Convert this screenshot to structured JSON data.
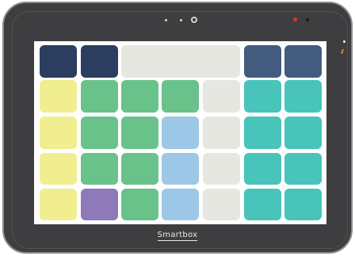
{
  "device": {
    "brand": "Smartbox"
  },
  "colors": {
    "navy": "#2b3e60",
    "slate": "#445b80",
    "gray": "#e7e7e2",
    "yellow": "#f0ee8e",
    "green": "#68c28a",
    "blue": "#9dc7e6",
    "teal": "#48c4ba",
    "purple": "#8f7ab9",
    "led": "#e03030"
  },
  "grid": {
    "rows": [
      [
        "navy",
        "navy",
        "gray-wide",
        "slate",
        "slate"
      ],
      [
        "yellow",
        "green",
        "green",
        "green",
        "gray",
        "teal",
        "teal"
      ],
      [
        "yellow",
        "green",
        "green",
        "blue",
        "gray",
        "teal",
        "teal"
      ],
      [
        "yellow",
        "green",
        "green",
        "blue",
        "gray",
        "teal",
        "teal"
      ],
      [
        "yellow",
        "purple",
        "green",
        "blue",
        "gray",
        "teal",
        "teal"
      ]
    ]
  }
}
